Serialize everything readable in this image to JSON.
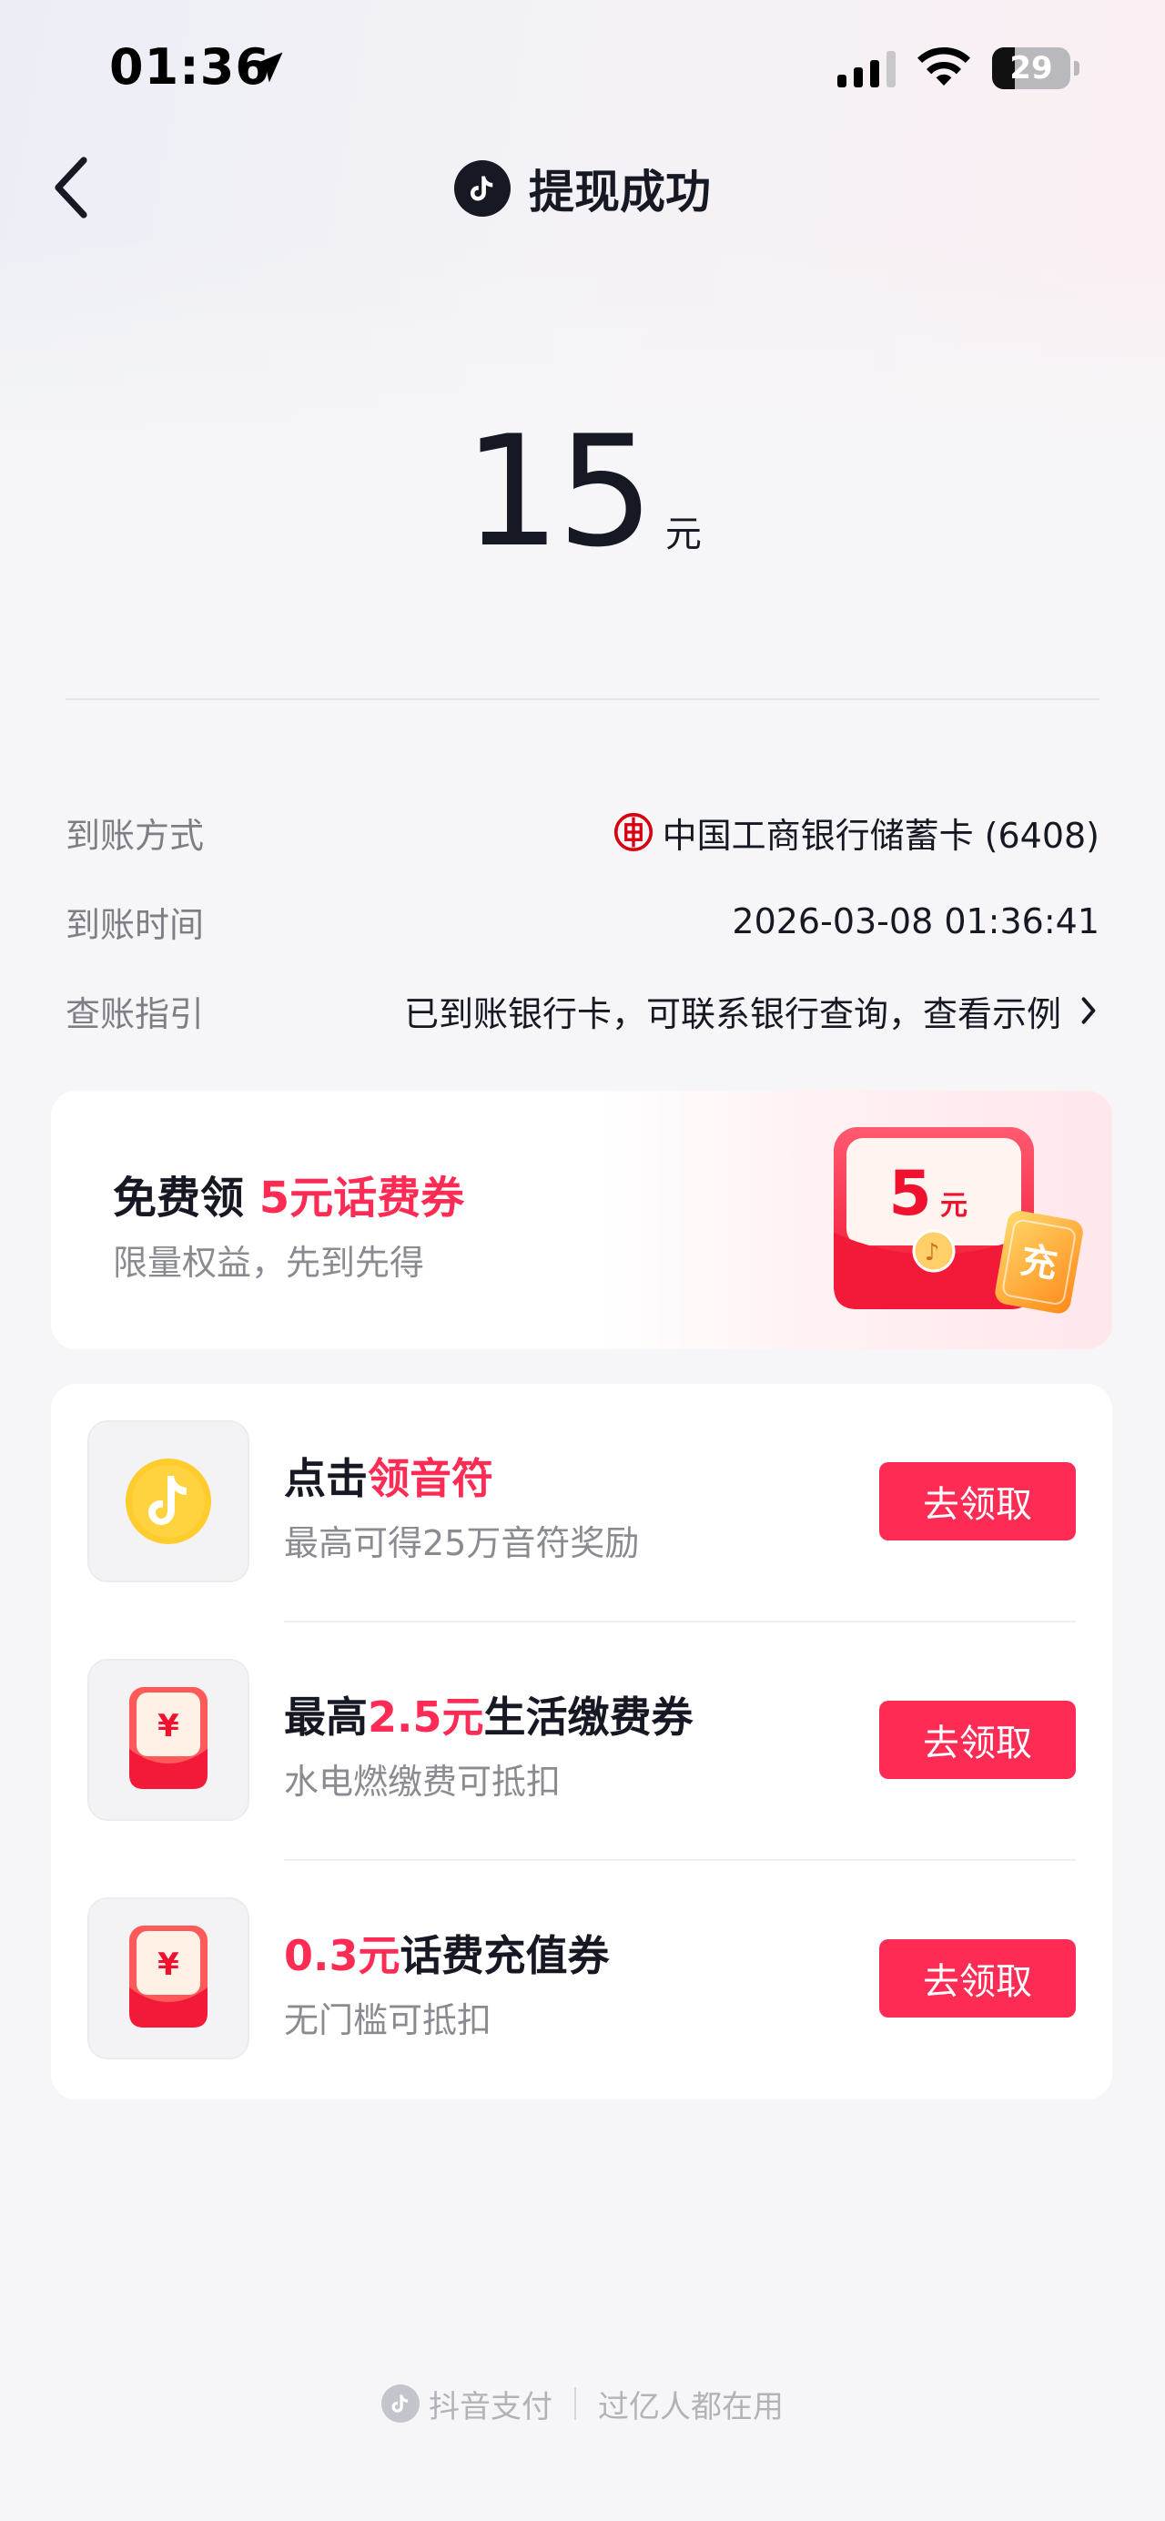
{
  "status_bar": {
    "time": "01:36",
    "battery_level": "29",
    "battery_fraction": 0.29
  },
  "nav": {
    "title": "提现成功"
  },
  "amount": {
    "value": "15",
    "unit": "元"
  },
  "details": [
    {
      "label": "到账方式",
      "value": "中国工商银行储蓄卡 (6408)",
      "icon": "icbc-bank-icon"
    },
    {
      "label": "到账时间",
      "value": "2026-03-08 01:36:41"
    },
    {
      "label": "查账指引",
      "value": "已到账银行卡，可联系银行查询，查看示例",
      "icon": "chevron-right-icon"
    }
  ],
  "promo": {
    "title_prefix": "免费领 ",
    "title_highlight": "5元话费券",
    "subtitle": "限量权益，先到先得",
    "envelope_amount": "5",
    "envelope_unit": "元",
    "envelope_tag": "充"
  },
  "tasks": [
    {
      "title_prefix": "点击",
      "title_highlight": "领音符",
      "title_suffix": "",
      "subtitle": "最高可得25万音符奖励",
      "button": "去领取",
      "icon": "music-note-coin-icon"
    },
    {
      "title_prefix": "最高",
      "title_highlight": "2.5元",
      "title_suffix": "生活缴费券",
      "subtitle": "水电燃缴费可抵扣",
      "button": "去领取",
      "icon": "red-envelope-icon"
    },
    {
      "title_prefix": "",
      "title_highlight": "0.3元",
      "title_suffix": "话费充值券",
      "subtitle": "无门槛可抵扣",
      "button": "去领取",
      "icon": "red-envelope-icon"
    }
  ],
  "footer": {
    "brand": "抖音支付",
    "slogan": "过亿人都在用"
  },
  "colors": {
    "accent": "#fe2c55",
    "text_primary": "#161823",
    "text_secondary": "#8a8b91",
    "background": "#f6f6f8"
  }
}
